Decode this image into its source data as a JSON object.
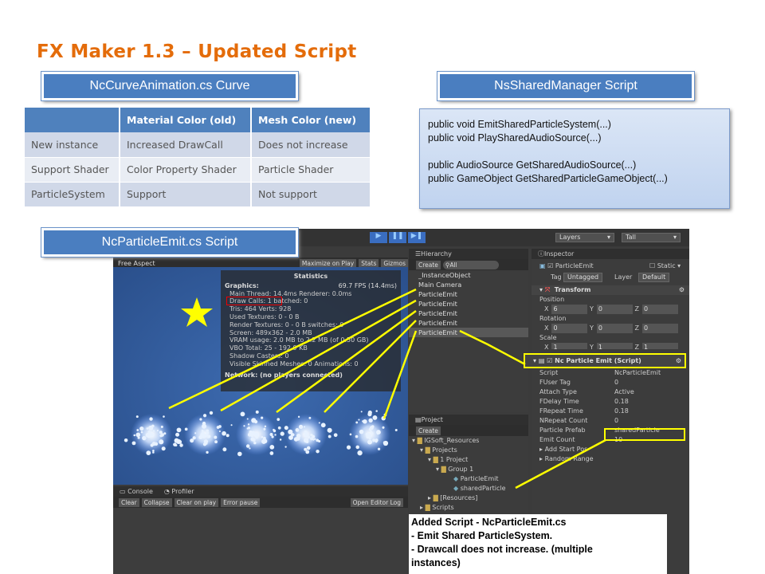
{
  "slide": {
    "title": "FX Maker 1.3 – Updated Script"
  },
  "labels": {
    "curve": "NcCurveAnimation.cs Curve",
    "shared": "NsSharedManager Script",
    "emit": "NcParticleEmit.cs Script"
  },
  "table": {
    "headers": [
      "",
      "Material Color (old)",
      "Mesh Color (new)"
    ],
    "rows": [
      [
        "New instance",
        "Increased DrawCall",
        "Does not increase"
      ],
      [
        "Support Shader",
        "Color Property Shader",
        "Particle Shader"
      ],
      [
        "ParticleSystem",
        "Support",
        "Not support"
      ]
    ]
  },
  "code": {
    "lines": [
      "public void EmitSharedParticleSystem(...)",
      "public void PlaySharedAudioSource(...)",
      "",
      "public AudioSource GetSharedAudioSource(...)",
      "public GameObject GetSharedParticleGameObject(...)"
    ]
  },
  "unity": {
    "toolbar": {
      "layers": "Layers",
      "layout": "Tall"
    },
    "game": {
      "aspect": "Free Aspect",
      "maximize": "Maximize on Play",
      "stats": "Stats",
      "gizmos": "Gizmos"
    },
    "statistics": {
      "title": "Statistics",
      "graphics": "Graphics:",
      "fps": "69.7 FPS (14.4ms)",
      "lines": [
        "Main Thread: 14.4ms   Renderer: 0.0ms",
        "Draw Calls: 1   batched: 0",
        "Tris: 464   Verts: 928",
        "Used Textures: 0 - 0 B",
        "Render Textures: 0 - 0 B   switches: 0",
        "Screen: 489x362 - 2.0 MB",
        "VRAM usage: 2.0 MB to 2.2 MB (of 0.50 GB)",
        "VBO Total: 25 - 192.9 KB",
        "Shadow Casters: 0",
        "Visible Skinned Meshes: 0    Animations: 0"
      ],
      "network": "Network: (no players connected)"
    },
    "hierarchy": {
      "title": "Hierarchy",
      "create": "Create",
      "search": "All",
      "items": [
        "_InstanceObject",
        "Main Camera",
        "ParticleEmit",
        "ParticleEmit",
        "ParticleEmit",
        "ParticleEmit",
        "ParticleEmit"
      ]
    },
    "inspector": {
      "title": "Inspector",
      "object": "ParticleEmit",
      "static": "Static",
      "tag_label": "Tag",
      "tag": "Untagged",
      "layer_label": "Layer",
      "layer": "Default",
      "transform": "Transform",
      "position": "Position",
      "rotation": "Rotation",
      "scale": "Scale",
      "pos": [
        "6",
        "0",
        "0"
      ],
      "rot": [
        "0",
        "0",
        "0"
      ],
      "scl": [
        "1",
        "1",
        "1"
      ],
      "axes": [
        "X",
        "Y",
        "Z"
      ],
      "component": "Nc Particle Emit (Script)",
      "fields": [
        [
          "Script",
          "NcParticleEmit"
        ],
        [
          "FUser Tag",
          "0"
        ],
        [
          "Attach Type",
          "Active"
        ],
        [
          "FDelay Time",
          "0.18"
        ],
        [
          "FRepeat Time",
          "0.18"
        ],
        [
          "NRepeat Count",
          "0"
        ],
        [
          "Particle Prefab",
          "sharedParticle"
        ],
        [
          "Emit Count",
          "10"
        ],
        [
          "Add Start Pos",
          ""
        ],
        [
          "Random Range",
          ""
        ]
      ]
    },
    "project": {
      "title": "Project",
      "create": "Create",
      "items": [
        "IGSoft_Resources",
        "Projects",
        "1 Project",
        "Group 1",
        "ParticleEmit",
        "sharedParticle",
        "[Resources]",
        "Scripts"
      ]
    },
    "console": {
      "tab": "Console",
      "profiler": "Profiler",
      "buttons": [
        "Clear",
        "Collapse",
        "Clear on play",
        "Error pause"
      ],
      "log": "Open Editor Log"
    }
  },
  "note": {
    "lines": [
      "Added Script - NcParticleEmit.cs",
      "- Emit Shared ParticleSystem.",
      "- Drawcall does not increase. (multiple",
      "instances)"
    ]
  },
  "colors": {
    "accent": "#e46c0a",
    "blue": "#4a7ec0",
    "highlight": "#ffff00"
  }
}
